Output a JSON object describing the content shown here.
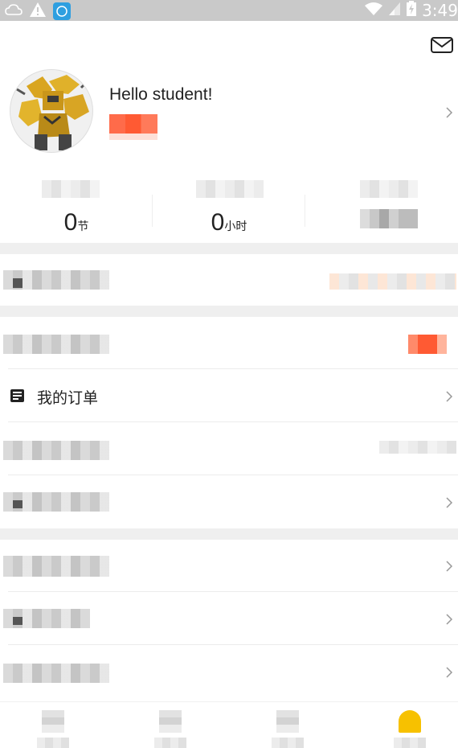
{
  "status_bar": {
    "time": "3:49",
    "icons": [
      "cloud-icon",
      "warning-icon",
      "app-notification-icon",
      "wifi-icon",
      "signal-icon",
      "battery-charging-icon"
    ],
    "background": "#c9c9c9"
  },
  "header": {
    "mail_icon": "mail-icon"
  },
  "profile": {
    "greeting": "Hello student!",
    "badge_color": "#ff5a33"
  },
  "stats": [
    {
      "value": "0",
      "unit": "节"
    },
    {
      "value": "0",
      "unit": "小时"
    },
    {
      "value": "",
      "unit": ""
    }
  ],
  "menu": {
    "orders_label": "我的订单",
    "orders_icon": "document-list-icon"
  },
  "colors": {
    "accent": "#ff5a33",
    "nav_active": "#f7c100",
    "divider": "#efefef"
  }
}
